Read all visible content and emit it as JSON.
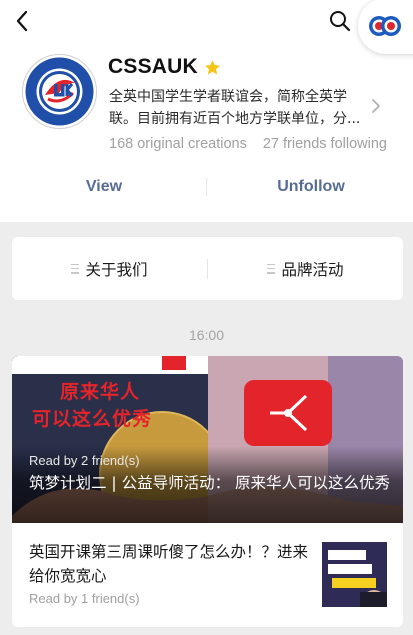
{
  "header": {
    "back_icon": "chevron-left-icon",
    "search_icon": "search-icon",
    "mini_program_icon": "mini-program-logo-icon"
  },
  "profile": {
    "name": "CSSAUK",
    "verified_icon": "star-icon",
    "description": "全英中国学生学者联谊会，简称全英学联。目前拥有近百个地方学联单位，分...",
    "original_creations": "168 original creations",
    "friends_following": "27 friends following",
    "view_label": "View",
    "unfollow_label": "Unfollow"
  },
  "menu": {
    "items": [
      {
        "label": "关于我们"
      },
      {
        "label": "品牌活动"
      }
    ]
  },
  "feed": {
    "time": "16:00",
    "articles": [
      {
        "read_by": "Read by 2 friend(s)",
        "title": "筑梦计划二 | 公益导师活动： 原来华人可以这么优秀",
        "cover_line1": "原来华人",
        "cover_line2": "可以这么优秀"
      },
      {
        "title": "英国开课第三周课听傻了怎么办！？进来给你宽宽心",
        "read_by": "Read by 1 friend(s)"
      }
    ]
  },
  "colors": {
    "link": "#576b95",
    "accent_red": "#e3242b",
    "star": "#f5c518"
  }
}
